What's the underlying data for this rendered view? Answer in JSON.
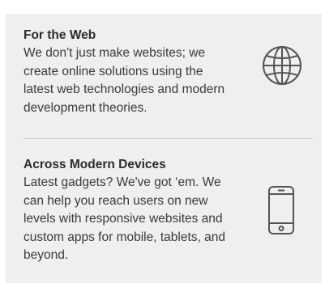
{
  "sections": [
    {
      "title": "For the Web",
      "lines": [
        "We don't just make websites; we",
        "create online solutions using the",
        "latest web technologies and modern",
        "development theories."
      ],
      "icon": "globe-icon"
    },
    {
      "title": "Across Modern Devices",
      "lines": [
        "Latest gadgets? We've got ‘em. We",
        "can help you reach users on new",
        "levels with responsive websites and",
        "custom apps for mobile, tablets, and",
        "beyond."
      ],
      "icon": "mobile-phone-icon"
    }
  ],
  "colors": {
    "panel_background": "#efefef",
    "text": "#333333",
    "icon_stroke": "#555555",
    "divider": "#c9c9c9"
  }
}
